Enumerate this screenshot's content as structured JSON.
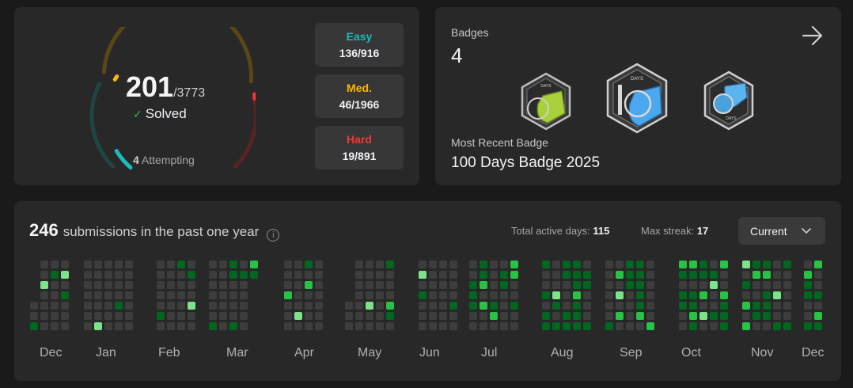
{
  "solved": {
    "count": "201",
    "total": "/3773",
    "label": "Solved",
    "attempting_count": "4",
    "attempting_label": "Attempting",
    "ring_colors": {
      "easy": "#1cbaba",
      "medium": "#ffb700",
      "hard": "#f63737"
    },
    "easy": {
      "label": "Easy",
      "value": "136/916"
    },
    "medium": {
      "label": "Med.",
      "value": "46/1966"
    },
    "hard": {
      "label": "Hard",
      "value": "19/891"
    }
  },
  "badges": {
    "title": "Badges",
    "count": "4",
    "arrow_icon": "arrow-right-icon",
    "items": [
      {
        "icon": "days-badge-green-icon",
        "text": "DAYS"
      },
      {
        "icon": "100-days-badge-icon",
        "text": "DAYS"
      },
      {
        "icon": "days-badge-blue-icon",
        "text": "DAYS"
      }
    ],
    "recent_title": "Most Recent Badge",
    "recent_name": "100 Days Badge 2025"
  },
  "calendar": {
    "count": "246",
    "title": "submissions in the past one year",
    "active_days_label": "Total active days:",
    "active_days_value": "115",
    "max_streak_label": "Max streak:",
    "max_streak_value": "17",
    "dropdown_value": "Current",
    "months": [
      "Dec",
      "Jan",
      "Feb",
      "Mar",
      "Apr",
      "May",
      "Jun",
      "Jul",
      "Aug",
      "Sep",
      "Oct",
      "Nov",
      "Dec"
    ],
    "colors": {
      "empty": "#3d3d3d",
      "level1": "#016620",
      "level2": "#28c244",
      "level3": "#7ce38b"
    }
  }
}
